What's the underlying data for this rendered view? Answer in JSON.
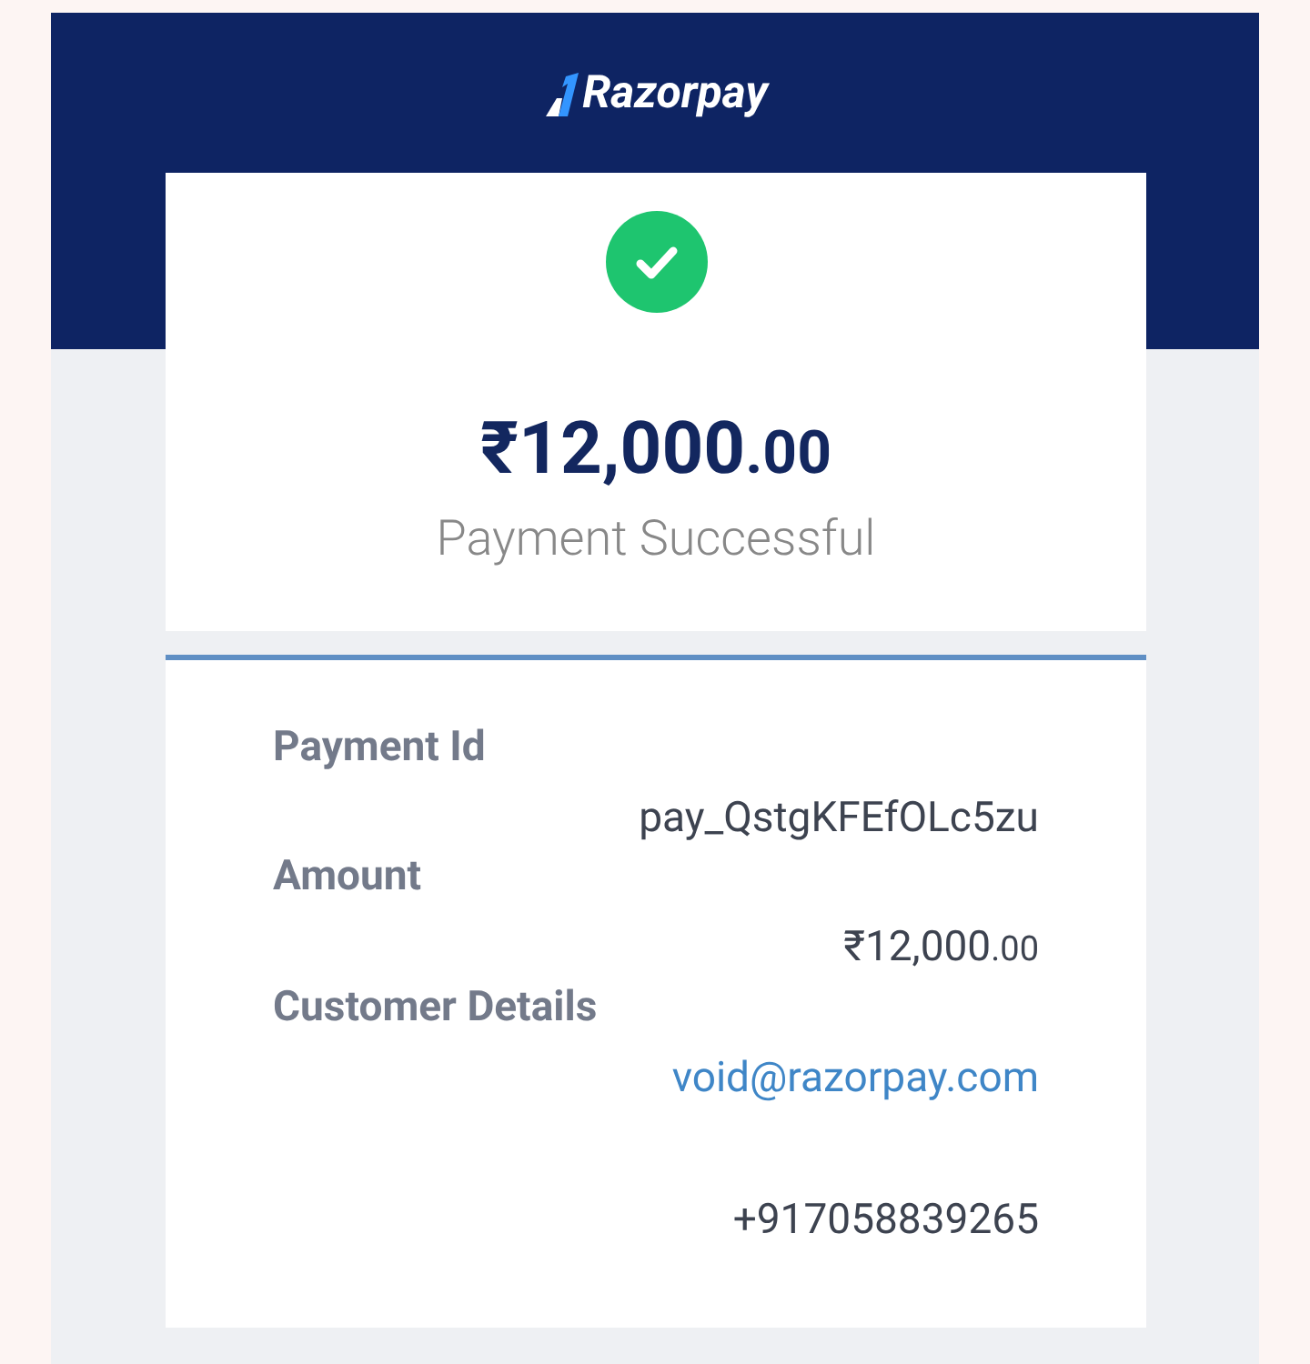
{
  "header": {
    "brand": "Razorpay"
  },
  "summary": {
    "succeeded": true,
    "amount": {
      "main": "₹12,000",
      "fraction": ".00"
    },
    "message": "Payment Successful"
  },
  "details": [
    {
      "label": "Payment Id",
      "values": [
        {
          "kind": "text",
          "text": "pay_QstgKFEfOLc5zu"
        }
      ]
    },
    {
      "label": "Amount",
      "values": [
        {
          "kind": "amount",
          "main": "₹12,000",
          "fraction": ".00"
        }
      ]
    },
    {
      "label": "Customer Details",
      "values": [
        {
          "kind": "link",
          "text": "void@razorpay.com"
        },
        {
          "kind": "text",
          "text": "+917058839265"
        }
      ]
    }
  ]
}
